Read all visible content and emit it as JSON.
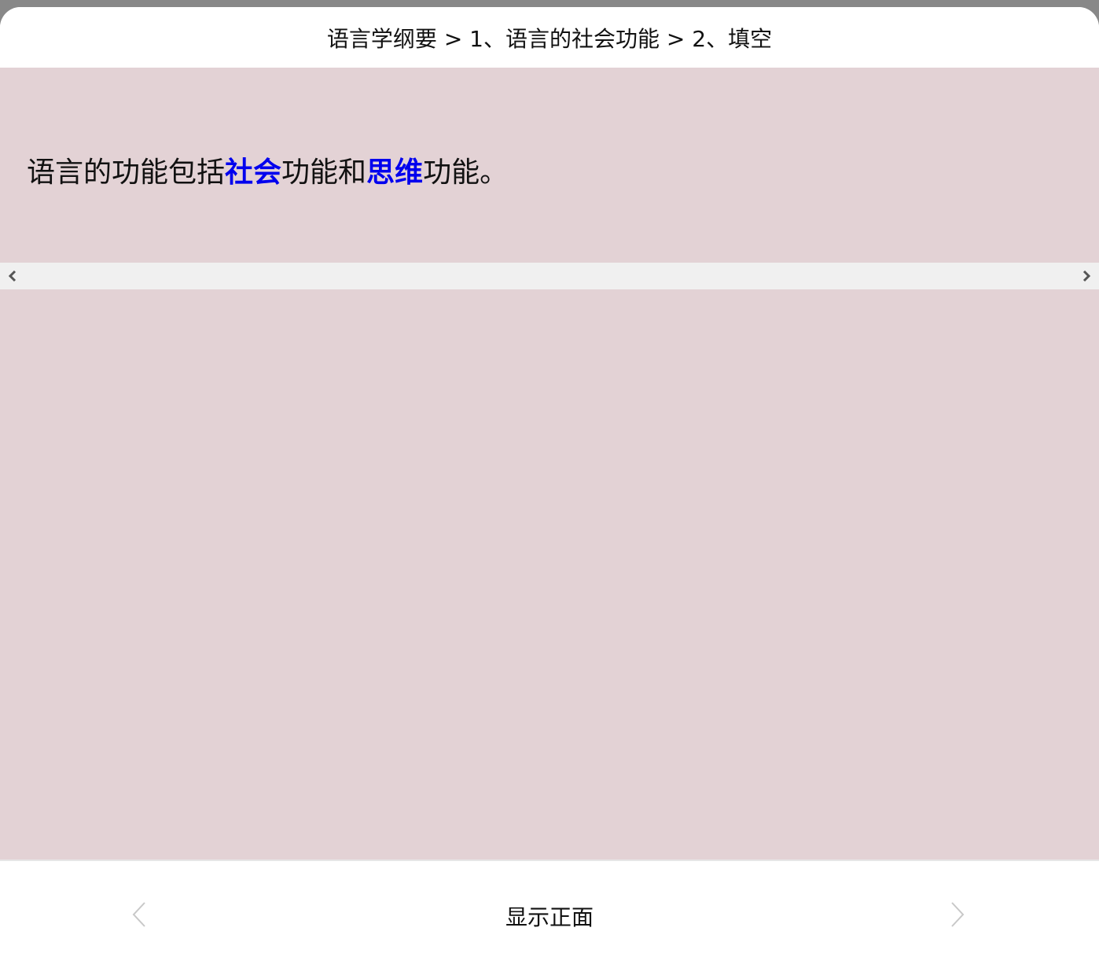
{
  "header": {
    "breadcrumb": "语言学纲要 > 1、语言的社会功能 > 2、填空"
  },
  "card": {
    "front_text_segments": {
      "part1": "语言的功能包括",
      "blank1": "社会",
      "part2": "功能和",
      "blank2": "思维",
      "part3": "功能。"
    },
    "background_color": "#e3d2d5",
    "blank_color": "#0000ee"
  },
  "splitter": {
    "left_icon": "chevron-left-icon",
    "right_icon": "chevron-right-icon"
  },
  "footer": {
    "show_front_label": "显示正面",
    "prev_icon": "chevron-left-icon",
    "next_icon": "chevron-right-icon"
  }
}
